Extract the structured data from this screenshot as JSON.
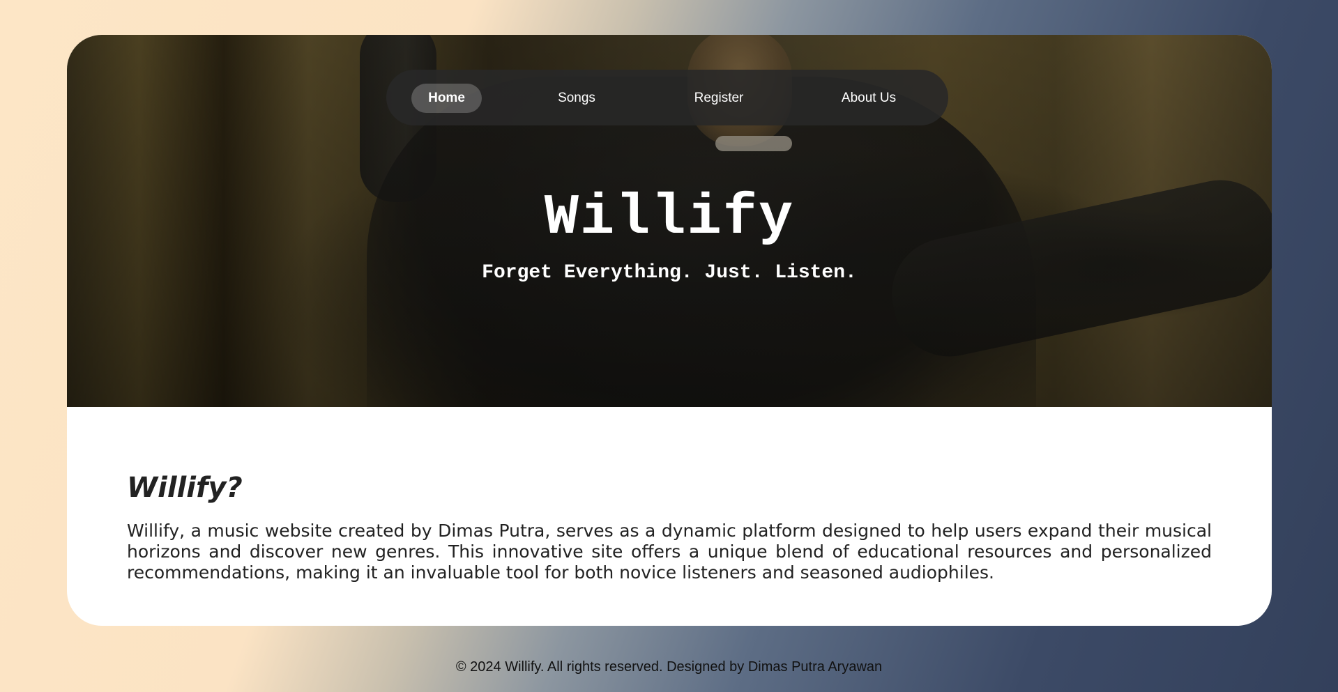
{
  "nav": {
    "items": [
      {
        "label": "Home",
        "active": true
      },
      {
        "label": "Songs",
        "active": false
      },
      {
        "label": "Register",
        "active": false
      },
      {
        "label": "About Us",
        "active": false
      }
    ]
  },
  "hero": {
    "title": "Willify",
    "tagline": "Forget Everything. Just. Listen."
  },
  "about": {
    "heading": "Willify?",
    "body": "Willify, a music website created by Dimas Putra, serves as a dynamic platform designed to help users expand their musical horizons and discover new genres. This innovative site offers a unique blend of educational resources and personalized recommendations, making it an invaluable tool for both novice listeners and seasoned audiophiles."
  },
  "footer": {
    "text": "© 2024 Willify. All rights reserved. Designed by Dimas Putra Aryawan"
  },
  "colors": {
    "nav_background": "#282828",
    "text_dark": "#222222",
    "background_left": "#fde6c6",
    "background_right": "#33405b"
  }
}
